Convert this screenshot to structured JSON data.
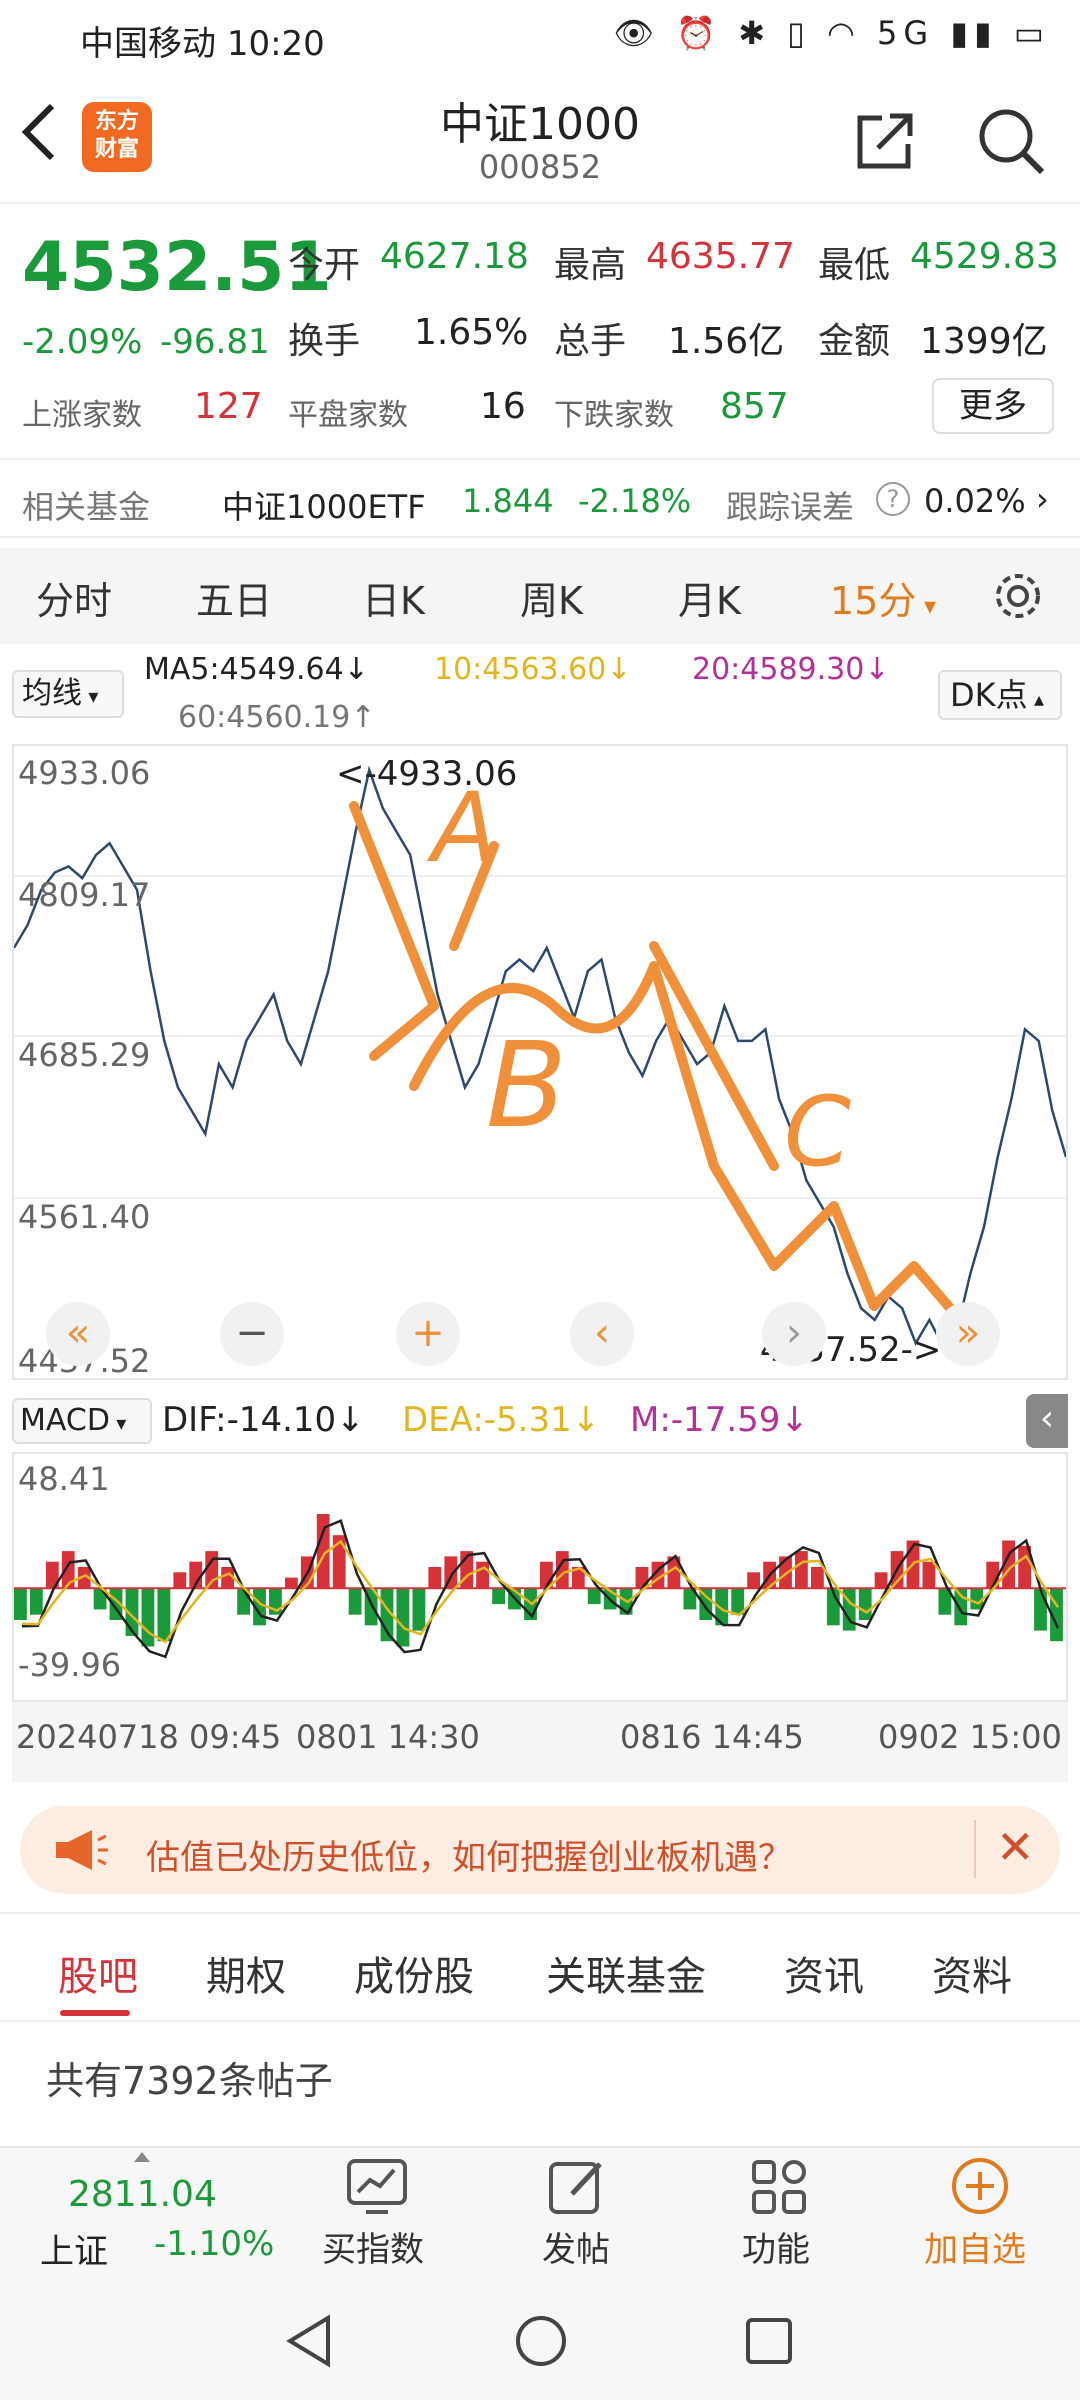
{
  "status_bar": {
    "carrier": "中国移动",
    "time": "10:20",
    "right_icons": "👁 ⏰ ✱ ▯ ◠ 5G ▮▮ ▭"
  },
  "header": {
    "title": "中证1000",
    "code": "000852",
    "logo_line1": "东方",
    "logo_line2": "财富"
  },
  "quote": {
    "price": "4532.51",
    "change_pct": "-2.09%",
    "change_val": "-96.81",
    "open_label": "今开",
    "open": "4627.18",
    "high_label": "最高",
    "high": "4635.77",
    "low_label": "最低",
    "low": "4529.83",
    "turnover_label": "换手",
    "turnover": "1.65%",
    "volume_label": "总手",
    "volume": "1.56亿",
    "amount_label": "金额",
    "amount": "1399亿",
    "up_label": "上涨家数",
    "up_count": "127",
    "flat_label": "平盘家数",
    "flat_count": "16",
    "down_label": "下跌家数",
    "down_count": "857",
    "more_label": "更多"
  },
  "fund": {
    "label": "相关基金",
    "name": "中证1000ETF",
    "price": "1.844",
    "pct": "-2.18%",
    "error_label": "跟踪误差",
    "error_value": "0.02%"
  },
  "period_tabs": [
    "分时",
    "五日",
    "日K",
    "周K",
    "月K",
    "15分"
  ],
  "ma": {
    "select_label": "均线",
    "ma5": "MA5:4549.64↓",
    "ma10": "10:4563.60↓",
    "ma20": "20:4589.30↓",
    "ma60": "60:4560.19↑",
    "dk_label": "DK点"
  },
  "chart": {
    "y_labels": [
      "4933.06",
      "4809.17",
      "4685.29",
      "4561.40",
      "4437.52"
    ],
    "max_marker": "<-4933.06",
    "min_marker": "4437.52->",
    "annotation_A": "A",
    "annotation_B": "B",
    "annotation_C": "C"
  },
  "chart_data": {
    "type": "line",
    "y_min": 4437.52,
    "y_max": 4933.06,
    "values": [
      4780,
      4800,
      4830,
      4845,
      4850,
      4840,
      4860,
      4870,
      4850,
      4830,
      4760,
      4700,
      4660,
      4640,
      4620,
      4680,
      4660,
      4700,
      4720,
      4740,
      4700,
      4680,
      4720,
      4760,
      4820,
      4880,
      4933.06,
      4900,
      4880,
      4860,
      4800,
      4740,
      4700,
      4660,
      4680,
      4720,
      4760,
      4770,
      4760,
      4780,
      4750,
      4720,
      4760,
      4770,
      4720,
      4690,
      4670,
      4700,
      4720,
      4700,
      4680,
      4690,
      4730,
      4700,
      4700,
      4710,
      4650,
      4620,
      4580,
      4560,
      4540,
      4500,
      4470,
      4460,
      4480,
      4470,
      4440,
      4460,
      4437.52,
      4450,
      4500,
      4540,
      4600,
      4650,
      4710,
      4700,
      4640,
      4600
    ],
    "macd": {
      "y_labels": [
        "48.41",
        "-39.96"
      ],
      "y_max": 48.41,
      "y_min": -39.96,
      "bars": [
        -12,
        -10,
        10,
        14,
        8,
        -8,
        -12,
        -18,
        -22,
        -20,
        6,
        10,
        14,
        8,
        -10,
        -14,
        -10,
        4,
        12,
        28,
        20,
        -10,
        -14,
        -20,
        -22,
        -16,
        8,
        12,
        14,
        10,
        -6,
        -8,
        -12,
        10,
        14,
        8,
        -6,
        -8,
        -10,
        8,
        10,
        12,
        -8,
        -12,
        -14,
        -10,
        6,
        10,
        12,
        14,
        8,
        -14,
        -16,
        -12,
        6,
        14,
        18,
        10,
        -10,
        -14,
        -8,
        10,
        18,
        16,
        -16,
        -20
      ]
    }
  },
  "macd": {
    "label": "MACD",
    "dif": "DIF:-14.10↓",
    "dea": "DEA:-5.31↓",
    "m": "M:-17.59↓"
  },
  "date_axis": [
    "20240718 09:45",
    "0801 14:30",
    "0816 14:45",
    "0902 15:00"
  ],
  "banner": {
    "text": "估值已处历史低位，如何把握创业板机遇？"
  },
  "bottom_tabs": [
    "股吧",
    "期权",
    "成份股",
    "关联基金",
    "资讯",
    "资料"
  ],
  "post_count": "共有7392条帖子",
  "bottom_nav": {
    "index_name": "上证",
    "index_value": "2811.04",
    "index_pct": "-1.10%",
    "buy_index": "买指数",
    "post": "发帖",
    "functions": "功能",
    "add_watch": "加自选"
  },
  "colors": {
    "up": "#d6323a",
    "down": "#1a9a3a",
    "accent": "#e27a1e",
    "line": "#2c4a70",
    "annotation": "#f0903a"
  }
}
